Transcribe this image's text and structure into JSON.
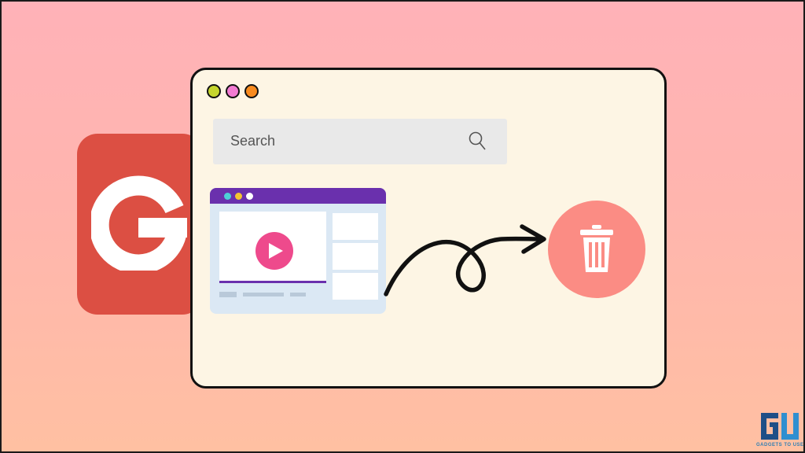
{
  "window": {
    "traffic_lights": [
      {
        "name": "close",
        "color": "#c5d52d"
      },
      {
        "name": "minimize",
        "color": "#f27bd2"
      },
      {
        "name": "maximize",
        "color": "#f88b1f"
      }
    ]
  },
  "search": {
    "placeholder": "Search",
    "icon": "search-icon"
  },
  "logos": {
    "google_letter": "G",
    "watermark": "GADGETS TO USE"
  },
  "illustration": {
    "video_card": "video-card",
    "arrow": "curly-arrow-icon",
    "trash": "trash-icon"
  },
  "colors": {
    "google_tile": "#dc4f43",
    "browser_bg": "#fdf5e4",
    "video_topbar": "#6a30ad",
    "play_button": "#ee4a8c",
    "trash_circle": "#fb8c84"
  }
}
